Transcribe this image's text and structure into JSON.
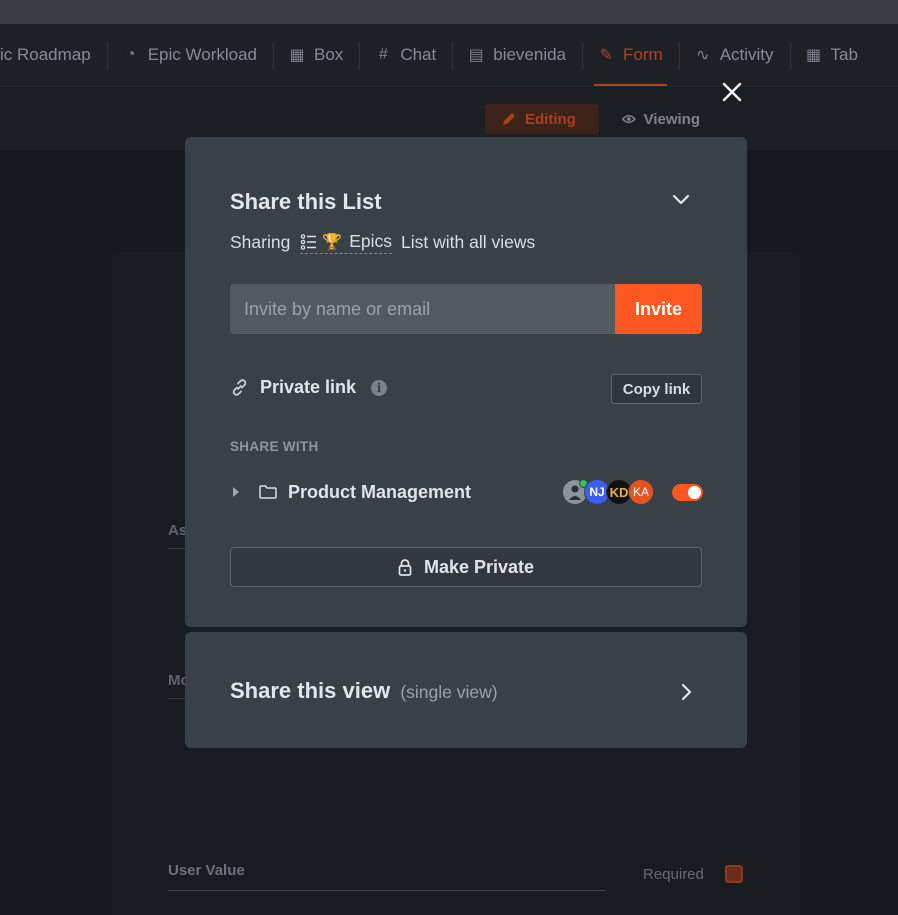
{
  "tabs": [
    {
      "label": "ic Roadmap",
      "icon": "roadmap-icon",
      "glyph": ""
    },
    {
      "label": "Epic Workload",
      "icon": "gauge-icon",
      "glyph": "◔"
    },
    {
      "label": "Box",
      "icon": "grid-icon",
      "glyph": "▦"
    },
    {
      "label": "Chat",
      "icon": "hash-icon",
      "glyph": "#"
    },
    {
      "label": "bievenida",
      "icon": "doc-icon",
      "glyph": "▤"
    },
    {
      "label": "Form",
      "icon": "form-icon",
      "glyph": "✎",
      "active": true
    },
    {
      "label": "Activity",
      "icon": "activity-icon",
      "glyph": "∿"
    },
    {
      "label": "Tab",
      "icon": "table-icon",
      "glyph": "▦"
    }
  ],
  "toolbar": {
    "editing": "Editing",
    "viewing": "Viewing"
  },
  "background_form": {
    "fragment_1": "As",
    "fragment_2": "Mo",
    "user_value_label": "User Value",
    "required_label": "Required"
  },
  "share_list": {
    "title": "Share this List",
    "sharing_prefix": "Sharing",
    "list_name": "Epics",
    "sharing_suffix": "List with all views",
    "invite_placeholder": "Invite by name or email",
    "invite_button": "Invite",
    "private_link_label": "Private link",
    "copy_link_button": "Copy link",
    "share_with_heading": "SHARE WITH",
    "workspace_name": "Product Management",
    "avatars": [
      {
        "initials": ""
      },
      {
        "initials": "NJ"
      },
      {
        "initials": "KD"
      },
      {
        "initials": "KA"
      }
    ],
    "shared_enabled": true,
    "make_private_button": "Make Private"
  },
  "share_view": {
    "title": "Share this view",
    "subtitle": "(single view)"
  },
  "colors": {
    "accent": "#ff5722",
    "modal_bg": "#384048",
    "page_bg": "#15191d"
  }
}
